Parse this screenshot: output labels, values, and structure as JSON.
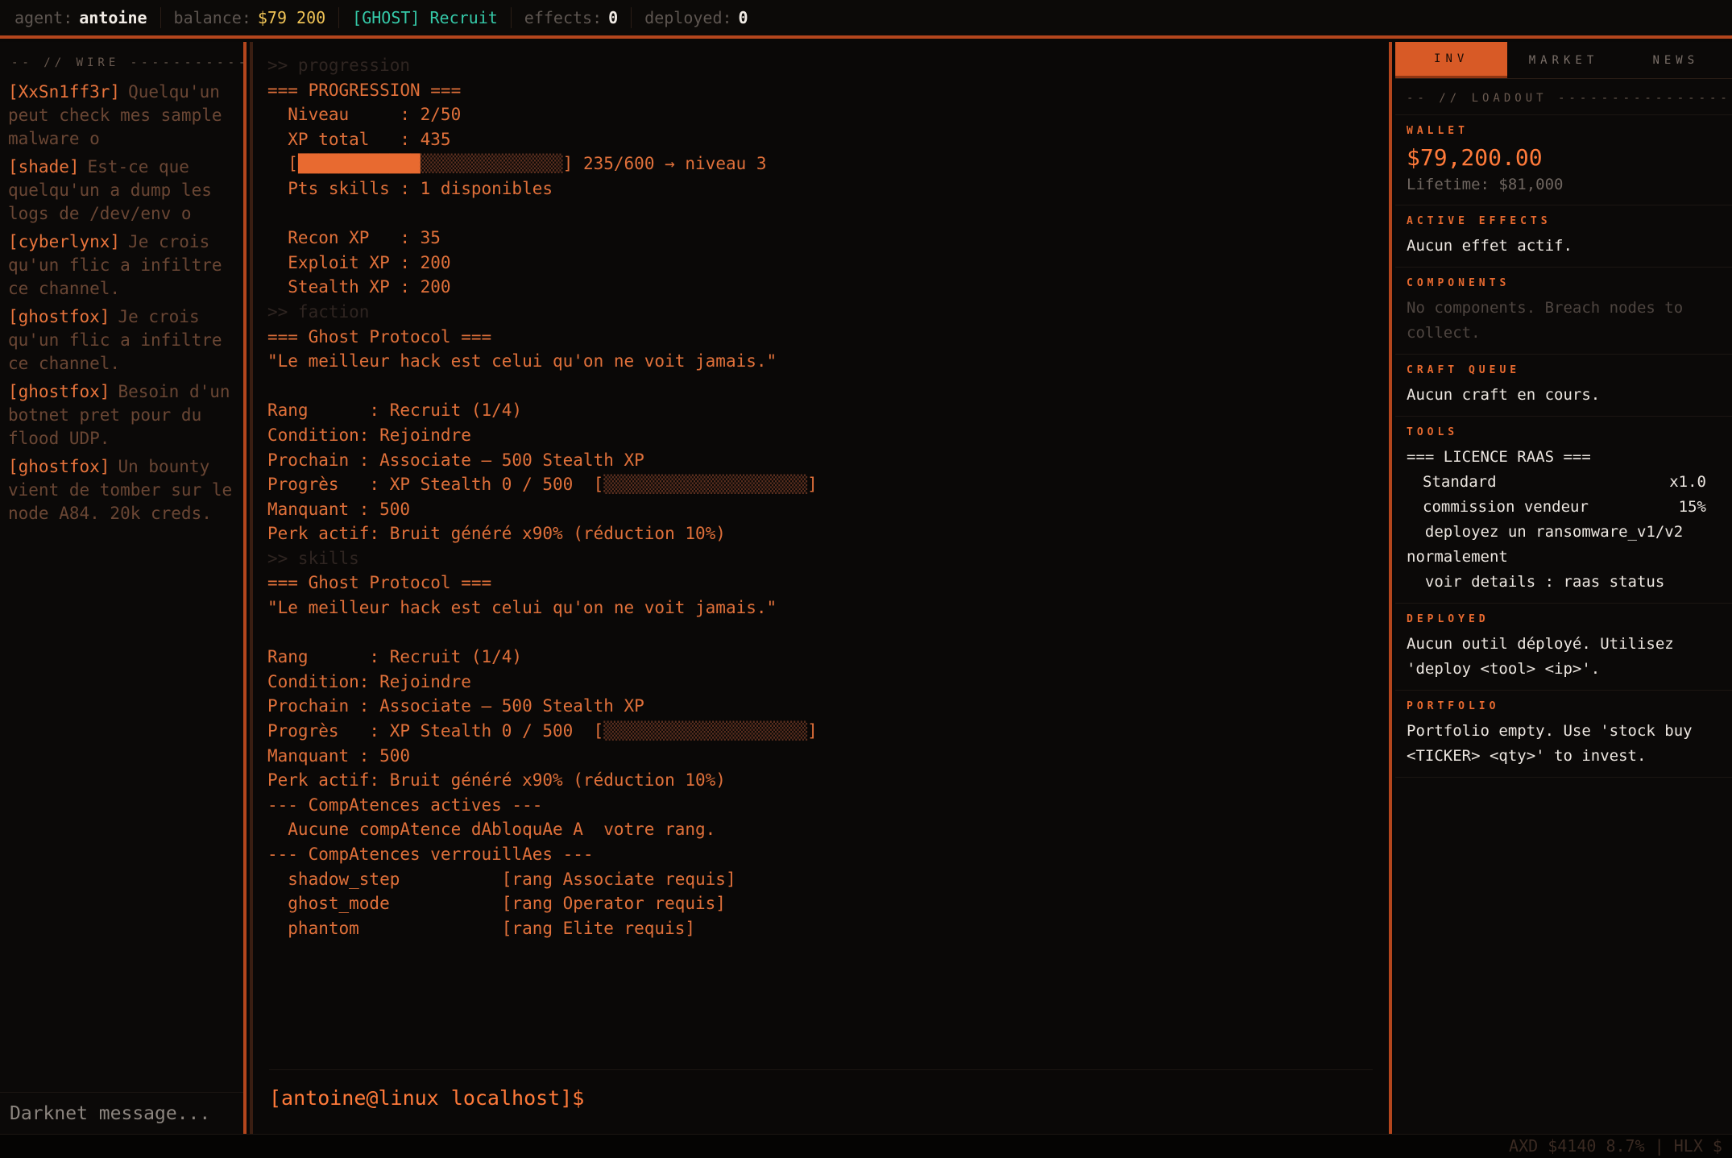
{
  "topbar": {
    "agent_label": "agent:",
    "agent_value": "antoine",
    "balance_label": "balance:",
    "balance_value": "$79 200",
    "faction_badge": "[GHOST] Recruit",
    "effects_label": "effects:",
    "effects_value": "0",
    "deployed_label": "deployed:",
    "deployed_value": "0"
  },
  "wire": {
    "header": "-- // WIRE -------------------------",
    "messages": [
      {
        "user": "[XxSn1ff3r]",
        "text": "Quelqu'un peut check mes sample malware o"
      },
      {
        "user": "[shade]",
        "text": "Est-ce que quelqu'un a dump les logs de /dev/env o"
      },
      {
        "user": "[cyberlynx]",
        "text": "Je crois qu'un flic a infiltre ce channel."
      },
      {
        "user": "[ghostfox]",
        "text": "Je crois qu'un flic a infiltre ce channel."
      },
      {
        "user": "[ghostfox]",
        "text": "Besoin d'un botnet pret pour du flood UDP."
      },
      {
        "user": "[ghostfox]",
        "text": "Un bounty vient de tomber sur le node A84. 20k creds."
      }
    ],
    "input_placeholder": "Darknet message..."
  },
  "terminal": {
    "lines": [
      {
        "cls": "dim",
        "text": ">> progression"
      },
      {
        "cls": "",
        "text": "=== PROGRESSION ==="
      },
      {
        "cls": "",
        "text": "  Niveau     : 2/50"
      },
      {
        "cls": "",
        "text": "  XP total   : 435"
      },
      {
        "cls": "",
        "text": "",
        "bar": {
          "prefix": "  [",
          "filled": "████████████",
          "empty": "▒▒▒▒▒▒▒▒▒▒▒▒▒▒",
          "suffix": "] 235/600 → niveau 3"
        }
      },
      {
        "cls": "",
        "text": "  Pts skills : 1 disponibles"
      },
      {
        "cls": "",
        "text": ""
      },
      {
        "cls": "",
        "text": "  Recon XP   : 35"
      },
      {
        "cls": "",
        "text": "  Exploit XP : 200"
      },
      {
        "cls": "",
        "text": "  Stealth XP : 200"
      },
      {
        "cls": "dim",
        "text": ">> faction"
      },
      {
        "cls": "",
        "text": "=== Ghost Protocol ==="
      },
      {
        "cls": "",
        "text": "\"Le meilleur hack est celui qu'on ne voit jamais.\""
      },
      {
        "cls": "",
        "text": ""
      },
      {
        "cls": "",
        "text": "Rang      : Recruit (1/4)"
      },
      {
        "cls": "",
        "text": "Condition: Rejoindre"
      },
      {
        "cls": "",
        "text": "Prochain : Associate — 500 Stealth XP"
      },
      {
        "cls": "",
        "text": "",
        "bar": {
          "prefix": "Progrès   : XP Stealth 0 / 500  [",
          "filled": "",
          "empty": "▒▒▒▒▒▒▒▒▒▒▒▒▒▒▒▒▒▒▒▒",
          "suffix": "]"
        }
      },
      {
        "cls": "",
        "text": "Manquant : 500"
      },
      {
        "cls": "",
        "text": "Perk actif: Bruit généré x90% (réduction 10%)"
      },
      {
        "cls": "dim",
        "text": ">> skills"
      },
      {
        "cls": "",
        "text": "=== Ghost Protocol ==="
      },
      {
        "cls": "",
        "text": "\"Le meilleur hack est celui qu'on ne voit jamais.\""
      },
      {
        "cls": "",
        "text": ""
      },
      {
        "cls": "",
        "text": "Rang      : Recruit (1/4)"
      },
      {
        "cls": "",
        "text": "Condition: Rejoindre"
      },
      {
        "cls": "",
        "text": "Prochain : Associate — 500 Stealth XP"
      },
      {
        "cls": "",
        "text": "",
        "bar": {
          "prefix": "Progrès   : XP Stealth 0 / 500  [",
          "filled": "",
          "empty": "▒▒▒▒▒▒▒▒▒▒▒▒▒▒▒▒▒▒▒▒",
          "suffix": "]"
        }
      },
      {
        "cls": "",
        "text": "Manquant : 500"
      },
      {
        "cls": "",
        "text": "Perk actif: Bruit généré x90% (réduction 10%)"
      },
      {
        "cls": "",
        "text": "--- CompAtences actives ---"
      },
      {
        "cls": "",
        "text": "  Aucune compAtence dAbloquAe A  votre rang."
      },
      {
        "cls": "",
        "text": "--- CompAtences verrouillAes ---"
      },
      {
        "cls": "",
        "text": "  shadow_step          [rang Associate requis]"
      },
      {
        "cls": "",
        "text": "  ghost_mode           [rang Operator requis]"
      },
      {
        "cls": "",
        "text": "  phantom              [rang Elite requis]"
      }
    ],
    "prompt": "[antoine@linux localhost]$"
  },
  "right": {
    "tabs": [
      "INV",
      "MARKET",
      "NEWS"
    ],
    "active_tab": "INV",
    "loadout_header": "-- // LOADOUT --------------------------",
    "wallet": {
      "title": "WALLET",
      "amount": "$79,200.00",
      "lifetime": "Lifetime: $81,000"
    },
    "effects": {
      "title": "ACTIVE EFFECTS",
      "text": "Aucun effet actif."
    },
    "components": {
      "title": "COMPONENTS",
      "text": "No components. Breach nodes to collect."
    },
    "craft": {
      "title": "CRAFT QUEUE",
      "text": "Aucun craft en cours."
    },
    "tools": {
      "title": "TOOLS",
      "heading": "=== LICENCE RAAS ===",
      "rows": [
        {
          "k": "Standard",
          "v": "x1.0"
        },
        {
          "k": "commission vendeur",
          "v": "15%"
        }
      ],
      "line1": "  deployez un ransomware_v1/v2",
      "line2": "normalement",
      "line3": "  voir details : raas status"
    },
    "deployed": {
      "title": "DEPLOYED",
      "text": "Aucun outil déployé. Utilisez 'deploy <tool> <ip>'."
    },
    "portfolio": {
      "title": "PORTFOLIO",
      "text": "Portfolio empty. Use 'stock buy <TICKER> <qty>' to invest."
    }
  },
  "ticker": {
    "text": "AXD $4140 8.7% | HLX $"
  },
  "colors": {
    "accent": "#e0703a",
    "border": "#b4461d",
    "gold": "#f0c456",
    "teal": "#35c9a8",
    "bg": "#0a0807"
  }
}
